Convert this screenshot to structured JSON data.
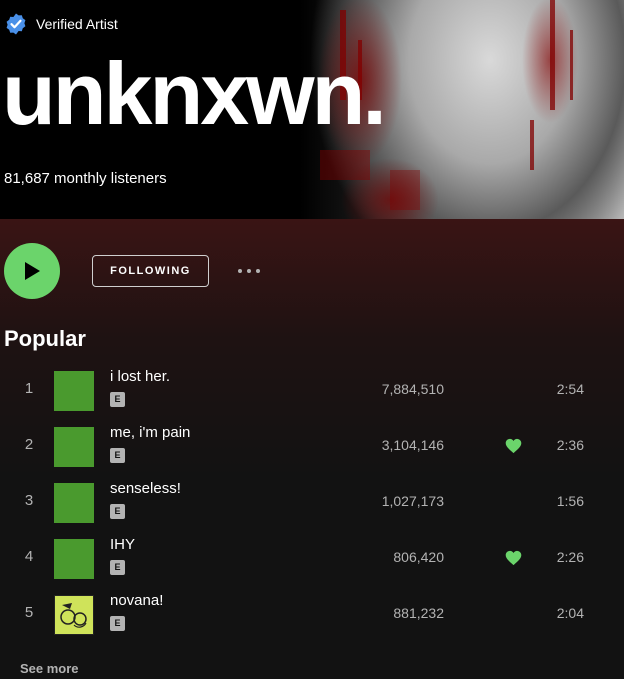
{
  "artist": {
    "verified_label": "Verified Artist",
    "name": "unknxwn.",
    "monthly_listeners": "81,687 monthly listeners"
  },
  "controls": {
    "follow_label": "FOLLOWING",
    "play_icon": "play-icon",
    "more_icon": "more-options-icon"
  },
  "popular": {
    "title": "Popular",
    "tracks": [
      {
        "rank": "1",
        "title": "i lost her.",
        "explicit": "E",
        "plays": "7,884,510",
        "liked": false,
        "duration": "2:54"
      },
      {
        "rank": "2",
        "title": "me, i'm pain",
        "explicit": "E",
        "plays": "3,104,146",
        "liked": true,
        "duration": "2:36"
      },
      {
        "rank": "3",
        "title": "senseless!",
        "explicit": "E",
        "plays": "1,027,173",
        "liked": false,
        "duration": "1:56"
      },
      {
        "rank": "4",
        "title": "IHY",
        "explicit": "E",
        "plays": "806,420",
        "liked": true,
        "duration": "2:26"
      },
      {
        "rank": "5",
        "title": "novana!",
        "explicit": "E",
        "plays": "881,232",
        "liked": false,
        "duration": "2:04"
      }
    ],
    "see_more": "See more"
  },
  "colors": {
    "accent_green": "#6bd46b",
    "background": "#121212",
    "header_gradient_top": "#3a1414"
  }
}
